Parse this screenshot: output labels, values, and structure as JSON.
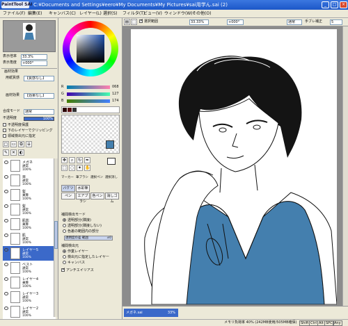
{
  "window": {
    "app_logo": "PaintTool SAI",
    "title": "C:¥Documents and Settings¥eero¥My Documents¥My Pictures¥sai用学ん.sai (2)"
  },
  "menu": [
    "ファイル(F)",
    "編集(E)",
    "キャンバス(C)",
    "レイヤー(L)",
    "選択(S)",
    "フィルタ(T)",
    "ビュー(V)",
    "ウィンドウ(W)",
    "その他(O)"
  ],
  "navigator": {
    "zoom_label": "表示倍率",
    "zoom_value": "33.3%",
    "angle_label": "表示角度",
    "angle_value": "+000°"
  },
  "layer_props": {
    "section_label": "画材効果",
    "paper_label": "用紙質感",
    "paper_value": "【質感なし】",
    "effect_label": "画材効果",
    "effect_value": "【効果なし】",
    "blend_label": "合成モード",
    "blend_value": "通常",
    "opacity_label": "不透明度",
    "opacity_value": "100%",
    "chk1": "不透明度保護",
    "chk2": "下のレイヤーでクリッピング",
    "chk3": "領域検出元に指定"
  },
  "layers": [
    {
      "name": "メガネ",
      "mode": "通常",
      "opacity": "100%",
      "selected": false
    },
    {
      "name": "目",
      "mode": "通常",
      "opacity": "100%",
      "selected": false
    },
    {
      "name": "髪",
      "mode": "乗算",
      "opacity": "100%",
      "selected": false
    },
    {
      "name": "髪",
      "mode": "通常",
      "opacity": "100%",
      "selected": false
    },
    {
      "name": "肌影",
      "mode": "乗算",
      "opacity": "100%",
      "selected": false
    },
    {
      "name": "肌",
      "mode": "通常",
      "opacity": "100%",
      "selected": false
    },
    {
      "name": "レイヤー5",
      "mode": "通常",
      "opacity": "100%",
      "selected": true
    },
    {
      "name": "ベスト",
      "mode": "通常",
      "opacity": "100%",
      "selected": false
    },
    {
      "name": "レイヤー4",
      "mode": "乗算",
      "opacity": "100%",
      "selected": false
    },
    {
      "name": "レイヤー3",
      "mode": "通常",
      "opacity": "100%",
      "selected": false
    },
    {
      "name": "レイヤー2",
      "mode": "通常",
      "opacity": "100%",
      "selected": false
    }
  ],
  "color": {
    "r_label": "R",
    "r_value": "068",
    "g_label": "G",
    "g_value": "127",
    "b_label": "B",
    "b_value": "174",
    "current": "#447fae"
  },
  "tool_tabs": [
    "マーカー",
    "筆ブラシ",
    "選択ペン",
    "選択消し"
  ],
  "tool_sub": [
    "バケツ",
    "水彩筆",
    "ペン",
    "エアブラシ",
    "色ペン",
    "消しゴム"
  ],
  "bucket": {
    "mode_title": "補間検出モード",
    "mode1": "透明部分(隣接)",
    "mode2": "透明部分(隣接しない)",
    "mode3": "色差の範囲内の部分",
    "tolerance_label": "透明度の差  範囲",
    "tolerance_value": "±0",
    "src_title": "補間検出元",
    "src1": "作業レイヤー",
    "src2": "検出元に指定したレイヤー",
    "src3": "キャンバス",
    "antialias": "アンチエイリアス"
  },
  "canvas_toolbar": {
    "select_label": "選択範囲",
    "zoom_value": "33.33%",
    "angle_value": "+000°",
    "mode_value": "通常",
    "stabilizer_label": "手ブレ補正",
    "stabilizer_value": "5"
  },
  "canvas_tab": {
    "name": "メガネ.sai",
    "zoom": "33%"
  },
  "status": {
    "memory": "メモリ負荷率 40% (242MB使用/505MB確保)",
    "keys": [
      "Shift",
      "Ctrl",
      "Alt",
      "SPC",
      "Any"
    ]
  }
}
